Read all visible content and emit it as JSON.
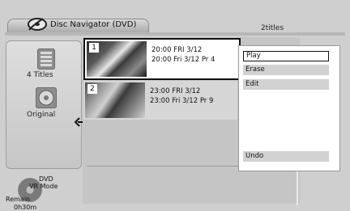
{
  "header": {
    "title": "Disc Navigator (DVD)",
    "titles_count": "2titles"
  },
  "left_panel": {
    "titles_label": "4 Titles",
    "original_label": "Original",
    "dvd_label": "DVD",
    "vr_mode_label": "VR Mode",
    "remain_label": "Remain",
    "remain_value": "0h30m"
  },
  "titles": [
    {
      "number": "1",
      "line1": "20:00  FRI 3/12",
      "line2": "20:00    Fri 3/12   Pr  4"
    },
    {
      "number": "2",
      "line1": "23:00  FRI 3/12",
      "line2": "23:00    Fri 3/12   Pr  9"
    }
  ],
  "menu": {
    "items": [
      "Play",
      "Erase",
      "Edit",
      "Undo"
    ],
    "selected": "Play"
  },
  "icons": {
    "header": "disc-navigator-icon",
    "titles": "titles-list-icon",
    "original": "original-disc-icon",
    "arrow": "left-arrow-icon",
    "dvd": "dvd-disc-icon"
  }
}
